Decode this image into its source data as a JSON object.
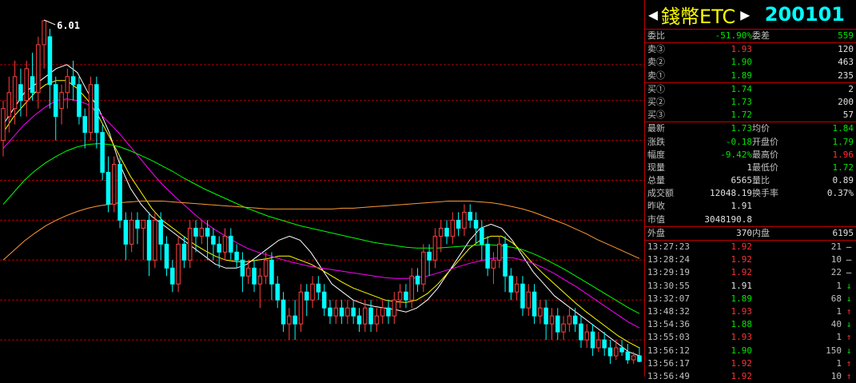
{
  "chart_data": {
    "type": "candlestick",
    "high_label": "6.01",
    "ylim": [
      1.6,
      6.2
    ],
    "gridlines": [
      5.45,
      5.0,
      4.5,
      4.0,
      3.5,
      3.0,
      2.5,
      2.0
    ],
    "colors": {
      "up": "#ff4040",
      "down": "#00ffff",
      "ma5": "#ffffff",
      "ma10": "#ffff00",
      "ma20": "#ff00ff",
      "ma30": "#00ff00",
      "ma60": "#ff9933",
      "grid": "#b00000"
    },
    "candles": [
      [
        4.5,
        4.9,
        5.0,
        4.3
      ],
      [
        4.8,
        5.1,
        5.3,
        4.6
      ],
      [
        4.9,
        5.3,
        5.5,
        4.7
      ],
      [
        5.2,
        5.0,
        5.4,
        4.8
      ],
      [
        5.0,
        5.4,
        5.5,
        4.8
      ],
      [
        5.3,
        5.1,
        5.6,
        5.0
      ],
      [
        5.1,
        5.7,
        5.8,
        4.9
      ],
      [
        5.7,
        6.0,
        6.01,
        5.4
      ],
      [
        5.8,
        5.2,
        5.9,
        4.9
      ],
      [
        5.2,
        4.8,
        5.3,
        4.5
      ],
      [
        4.9,
        5.1,
        5.2,
        4.7
      ],
      [
        5.1,
        5.3,
        5.4,
        4.9
      ],
      [
        5.3,
        5.2,
        5.5,
        5.0
      ],
      [
        5.2,
        4.8,
        5.3,
        4.7
      ],
      [
        4.8,
        4.6,
        4.9,
        4.4
      ],
      [
        4.6,
        5.2,
        5.3,
        4.5
      ],
      [
        5.2,
        4.6,
        5.3,
        4.4
      ],
      [
        4.6,
        4.1,
        4.7,
        4.0
      ],
      [
        4.1,
        3.7,
        4.3,
        3.6
      ],
      [
        3.7,
        4.2,
        4.3,
        3.6
      ],
      [
        4.2,
        3.5,
        4.3,
        3.4
      ],
      [
        3.5,
        3.2,
        3.6,
        3.0
      ],
      [
        3.2,
        3.5,
        3.6,
        3.1
      ],
      [
        3.5,
        3.4,
        3.6,
        3.2
      ],
      [
        3.4,
        3.5,
        3.5,
        3.0
      ],
      [
        3.5,
        3.0,
        3.6,
        2.8
      ],
      [
        3.0,
        3.5,
        3.6,
        2.9
      ],
      [
        3.5,
        3.2,
        3.6,
        3.0
      ],
      [
        3.2,
        2.9,
        3.3,
        2.8
      ],
      [
        2.9,
        2.7,
        3.0,
        2.6
      ],
      [
        2.7,
        3.2,
        3.3,
        2.6
      ],
      [
        3.2,
        3.0,
        3.3,
        2.9
      ],
      [
        3.0,
        3.4,
        3.5,
        2.9
      ],
      [
        3.4,
        3.3,
        3.5,
        3.1
      ],
      [
        3.3,
        3.4,
        3.5,
        3.2
      ],
      [
        3.4,
        3.3,
        3.5,
        3.0
      ],
      [
        3.3,
        3.2,
        3.4,
        3.0
      ],
      [
        3.2,
        3.1,
        3.3,
        2.9
      ],
      [
        3.1,
        3.3,
        3.4,
        3.0
      ],
      [
        3.3,
        3.1,
        3.4,
        3.0
      ],
      [
        3.1,
        3.0,
        3.2,
        2.9
      ],
      [
        3.0,
        2.8,
        3.1,
        2.6
      ],
      [
        2.8,
        2.9,
        3.0,
        2.7
      ],
      [
        2.9,
        2.7,
        3.0,
        2.6
      ],
      [
        2.7,
        2.8,
        2.9,
        2.4
      ],
      [
        2.8,
        3.0,
        3.1,
        2.7
      ],
      [
        3.0,
        2.7,
        3.1,
        2.5
      ],
      [
        2.7,
        2.5,
        2.8,
        2.4
      ],
      [
        2.5,
        2.2,
        2.6,
        2.1
      ],
      [
        2.2,
        2.3,
        2.4,
        2.0
      ],
      [
        2.3,
        2.2,
        2.5,
        2.0
      ],
      [
        2.2,
        2.6,
        2.7,
        2.1
      ],
      [
        2.6,
        2.5,
        2.7,
        2.3
      ],
      [
        2.5,
        2.7,
        2.8,
        2.4
      ],
      [
        2.7,
        2.6,
        2.8,
        2.5
      ],
      [
        2.6,
        2.4,
        2.7,
        2.3
      ],
      [
        2.4,
        2.3,
        2.5,
        2.2
      ],
      [
        2.3,
        2.4,
        2.5,
        2.2
      ],
      [
        2.4,
        2.3,
        2.5,
        2.2
      ],
      [
        2.3,
        2.4,
        2.5,
        2.2
      ],
      [
        2.4,
        2.3,
        2.5,
        2.2
      ],
      [
        2.3,
        2.2,
        2.4,
        2.1
      ],
      [
        2.2,
        2.4,
        2.5,
        2.1
      ],
      [
        2.4,
        2.2,
        2.5,
        2.1
      ],
      [
        2.2,
        2.3,
        2.4,
        2.1
      ],
      [
        2.3,
        2.4,
        2.5,
        2.2
      ],
      [
        2.4,
        2.3,
        2.5,
        2.2
      ],
      [
        2.3,
        2.5,
        2.6,
        2.2
      ],
      [
        2.5,
        2.6,
        2.7,
        2.4
      ],
      [
        2.6,
        2.5,
        2.7,
        2.4
      ],
      [
        2.5,
        2.8,
        2.9,
        2.4
      ],
      [
        2.8,
        2.7,
        2.9,
        2.6
      ],
      [
        2.7,
        3.1,
        3.2,
        2.6
      ],
      [
        3.1,
        3.0,
        3.2,
        2.8
      ],
      [
        3.0,
        3.3,
        3.4,
        2.9
      ],
      [
        3.3,
        3.4,
        3.5,
        3.1
      ],
      [
        3.4,
        3.3,
        3.5,
        3.2
      ],
      [
        3.3,
        3.5,
        3.6,
        3.2
      ],
      [
        3.5,
        3.4,
        3.6,
        3.3
      ],
      [
        3.4,
        3.6,
        3.7,
        3.3
      ],
      [
        3.6,
        3.5,
        3.7,
        3.4
      ],
      [
        3.5,
        3.4,
        3.6,
        3.2
      ],
      [
        3.4,
        3.2,
        3.5,
        3.0
      ],
      [
        3.2,
        2.9,
        3.3,
        2.8
      ],
      [
        2.9,
        3.0,
        3.1,
        2.7
      ],
      [
        3.0,
        3.2,
        3.3,
        2.9
      ],
      [
        3.2,
        2.8,
        3.3,
        2.6
      ],
      [
        2.8,
        2.6,
        2.9,
        2.5
      ],
      [
        2.6,
        2.7,
        2.8,
        2.5
      ],
      [
        2.7,
        2.4,
        2.8,
        2.3
      ],
      [
        2.4,
        2.6,
        2.7,
        2.3
      ],
      [
        2.6,
        2.3,
        2.7,
        2.2
      ],
      [
        2.3,
        2.4,
        2.5,
        2.2
      ],
      [
        2.4,
        2.2,
        2.5,
        2.0
      ],
      [
        2.2,
        2.3,
        2.4,
        2.0
      ],
      [
        2.3,
        2.1,
        2.4,
        2.0
      ],
      [
        2.1,
        2.2,
        2.3,
        2.0
      ],
      [
        2.2,
        2.3,
        2.4,
        2.1
      ],
      [
        2.3,
        2.2,
        2.4,
        2.1
      ],
      [
        2.2,
        2.0,
        2.3,
        1.9
      ],
      [
        2.0,
        2.1,
        2.2,
        1.9
      ],
      [
        2.1,
        1.9,
        2.2,
        1.8
      ],
      [
        1.9,
        2.0,
        2.1,
        1.85
      ],
      [
        2.0,
        1.9,
        2.1,
        1.8
      ],
      [
        1.9,
        1.8,
        2.0,
        1.7
      ],
      [
        1.8,
        1.9,
        2.0,
        1.75
      ],
      [
        1.9,
        1.85,
        2.0,
        1.8
      ],
      [
        1.85,
        1.75,
        1.95,
        1.7
      ],
      [
        1.75,
        1.8,
        1.85,
        1.7
      ],
      [
        1.8,
        1.73,
        1.91,
        1.72
      ]
    ],
    "ma": [
      {
        "key": "ma5",
        "values": [
          4.7,
          4.9,
          5.1,
          5.2,
          5.3,
          5.4,
          5.45,
          5.35,
          5.1,
          4.9,
          4.6,
          4.2,
          3.9,
          3.7,
          3.55,
          3.45,
          3.35,
          3.25,
          3.15,
          3.05,
          2.95,
          2.9,
          2.9,
          2.95,
          3.05,
          3.15,
          3.25,
          3.3,
          3.25,
          3.1,
          2.9,
          2.7,
          2.6,
          2.5,
          2.45,
          2.42,
          2.4,
          2.38,
          2.35,
          2.4,
          2.5,
          2.65,
          2.85,
          3.05,
          3.25,
          3.4,
          3.45,
          3.4,
          3.25,
          3.05,
          2.85,
          2.7,
          2.55,
          2.45,
          2.35,
          2.25,
          2.15,
          2.05,
          1.95,
          1.85,
          1.8
        ]
      },
      {
        "key": "ma10",
        "values": [
          4.6,
          4.8,
          4.95,
          5.1,
          5.2,
          5.25,
          5.25,
          5.15,
          5.0,
          4.8,
          4.55,
          4.3,
          4.05,
          3.85,
          3.65,
          3.5,
          3.4,
          3.3,
          3.2,
          3.12,
          3.05,
          3.0,
          2.98,
          2.98,
          3.0,
          3.02,
          3.05,
          3.05,
          3.0,
          2.95,
          2.88,
          2.8,
          2.72,
          2.65,
          2.6,
          2.55,
          2.5,
          2.48,
          2.47,
          2.5,
          2.58,
          2.7,
          2.85,
          3.0,
          3.15,
          3.25,
          3.3,
          3.3,
          3.22,
          3.1,
          2.95,
          2.82,
          2.7,
          2.58,
          2.46,
          2.35,
          2.25,
          2.15,
          2.05,
          1.97,
          1.9
        ]
      },
      {
        "key": "ma20",
        "values": [
          4.4,
          4.55,
          4.7,
          4.82,
          4.92,
          5.0,
          5.02,
          5.0,
          4.95,
          4.85,
          4.72,
          4.58,
          4.42,
          4.26,
          4.1,
          3.95,
          3.82,
          3.7,
          3.58,
          3.47,
          3.38,
          3.3,
          3.22,
          3.15,
          3.1,
          3.06,
          3.02,
          2.98,
          2.95,
          2.92,
          2.9,
          2.88,
          2.86,
          2.84,
          2.82,
          2.8,
          2.78,
          2.77,
          2.77,
          2.78,
          2.8,
          2.84,
          2.88,
          2.92,
          2.96,
          2.99,
          3.02,
          3.03,
          3.03,
          3.0,
          2.96,
          2.9,
          2.83,
          2.75,
          2.67,
          2.58,
          2.49,
          2.4,
          2.31,
          2.22,
          2.15
        ]
      },
      {
        "key": "ma30",
        "values": [
          3.7,
          3.85,
          4.0,
          4.12,
          4.22,
          4.3,
          4.37,
          4.42,
          4.45,
          4.46,
          4.45,
          4.42,
          4.37,
          4.31,
          4.25,
          4.18,
          4.11,
          4.03,
          3.96,
          3.89,
          3.83,
          3.77,
          3.71,
          3.65,
          3.6,
          3.55,
          3.51,
          3.47,
          3.43,
          3.4,
          3.37,
          3.34,
          3.31,
          3.28,
          3.25,
          3.22,
          3.2,
          3.18,
          3.16,
          3.15,
          3.15,
          3.15,
          3.16,
          3.17,
          3.18,
          3.19,
          3.19,
          3.18,
          3.16,
          3.13,
          3.08,
          3.02,
          2.95,
          2.88,
          2.8,
          2.72,
          2.64,
          2.56,
          2.48,
          2.4,
          2.33
        ]
      },
      {
        "key": "ma60",
        "values": [
          3.0,
          3.12,
          3.24,
          3.34,
          3.43,
          3.5,
          3.56,
          3.61,
          3.65,
          3.68,
          3.7,
          3.72,
          3.73,
          3.74,
          3.74,
          3.74,
          3.73,
          3.72,
          3.71,
          3.7,
          3.69,
          3.68,
          3.67,
          3.66,
          3.65,
          3.64,
          3.64,
          3.64,
          3.64,
          3.64,
          3.64,
          3.64,
          3.65,
          3.65,
          3.66,
          3.67,
          3.68,
          3.69,
          3.7,
          3.71,
          3.72,
          3.73,
          3.74,
          3.74,
          3.74,
          3.73,
          3.72,
          3.7,
          3.67,
          3.64,
          3.6,
          3.55,
          3.5,
          3.45,
          3.39,
          3.33,
          3.26,
          3.2,
          3.14,
          3.08,
          3.02
        ]
      }
    ]
  },
  "panel": {
    "arrow_left": "◀",
    "arrow_right": "▶",
    "name": "錢幣ETC",
    "code": "200101",
    "weibi_label": "委比",
    "weibi_value": "-51.90%",
    "weicha_label": "委差",
    "weicha_value": "559",
    "asks": [
      {
        "label": "卖③",
        "price": "1.93",
        "vol": "120"
      },
      {
        "label": "卖②",
        "price": "1.90",
        "vol": "463"
      },
      {
        "label": "卖①",
        "price": "1.89",
        "vol": "235"
      }
    ],
    "bids": [
      {
        "label": "买①",
        "price": "1.74",
        "vol": "2"
      },
      {
        "label": "买②",
        "price": "1.73",
        "vol": "200"
      },
      {
        "label": "买③",
        "price": "1.72",
        "vol": "57"
      }
    ],
    "stats": [
      {
        "l1": "最新",
        "v1": "1.73",
        "c1": "green",
        "l2": "均价",
        "v2": "1.84",
        "c2": "green"
      },
      {
        "l1": "涨跌",
        "v1": "-0.18",
        "c1": "green",
        "l2": "开盘价",
        "v2": "1.79",
        "c2": "green"
      },
      {
        "l1": "幅度",
        "v1": "-9.42%",
        "c1": "green",
        "l2": "最高价",
        "v2": "1.96",
        "c2": "red"
      },
      {
        "l1": "现量",
        "v1": "1",
        "c1": "white",
        "l2": "最低价",
        "v2": "1.72",
        "c2": "green"
      },
      {
        "l1": "总量",
        "v1": "6565",
        "c1": "white",
        "l2": "量比",
        "v2": "0.89",
        "c2": "white"
      },
      {
        "l1": "成交额",
        "v1": "12048.19",
        "c1": "white",
        "l2": "换手率",
        "v2": "0.37%",
        "c2": "white"
      },
      {
        "l1": "昨收",
        "v1": "1.91",
        "c1": "white",
        "l2": "",
        "v2": "",
        "c2": "white"
      },
      {
        "l1": "市值",
        "v1": "3048190.8",
        "c1": "white",
        "l2": "",
        "v2": "",
        "c2": "white"
      }
    ],
    "outer_label": "外盘",
    "outer_value": "370",
    "inner_label": "内盘",
    "inner_value": "6195",
    "ticks": [
      {
        "time": "13:27:23",
        "price": "1.92",
        "pc": "red",
        "qty": "21",
        "dir": "—",
        "dc": "white"
      },
      {
        "time": "13:28:24",
        "price": "1.92",
        "pc": "red",
        "qty": "10",
        "dir": "—",
        "dc": "white"
      },
      {
        "time": "13:29:19",
        "price": "1.92",
        "pc": "red",
        "qty": "22",
        "dir": "—",
        "dc": "white"
      },
      {
        "time": "13:30:55",
        "price": "1.91",
        "pc": "white",
        "qty": "1",
        "dir": "↓",
        "dc": "green"
      },
      {
        "time": "13:32:07",
        "price": "1.89",
        "pc": "green",
        "qty": "68",
        "dir": "↓",
        "dc": "green"
      },
      {
        "time": "13:48:32",
        "price": "1.93",
        "pc": "red",
        "qty": "1",
        "dir": "↑",
        "dc": "red"
      },
      {
        "time": "13:54:36",
        "price": "1.88",
        "pc": "green",
        "qty": "40",
        "dir": "↓",
        "dc": "green"
      },
      {
        "time": "13:55:03",
        "price": "1.93",
        "pc": "red",
        "qty": "1",
        "dir": "↑",
        "dc": "red"
      },
      {
        "time": "13:56:12",
        "price": "1.90",
        "pc": "green",
        "qty": "150",
        "dir": "↓",
        "dc": "green"
      },
      {
        "time": "13:56:17",
        "price": "1.92",
        "pc": "red",
        "qty": "1",
        "dir": "↑",
        "dc": "red"
      },
      {
        "time": "13:56:49",
        "price": "1.92",
        "pc": "red",
        "qty": "10",
        "dir": "↑",
        "dc": "red"
      }
    ]
  }
}
